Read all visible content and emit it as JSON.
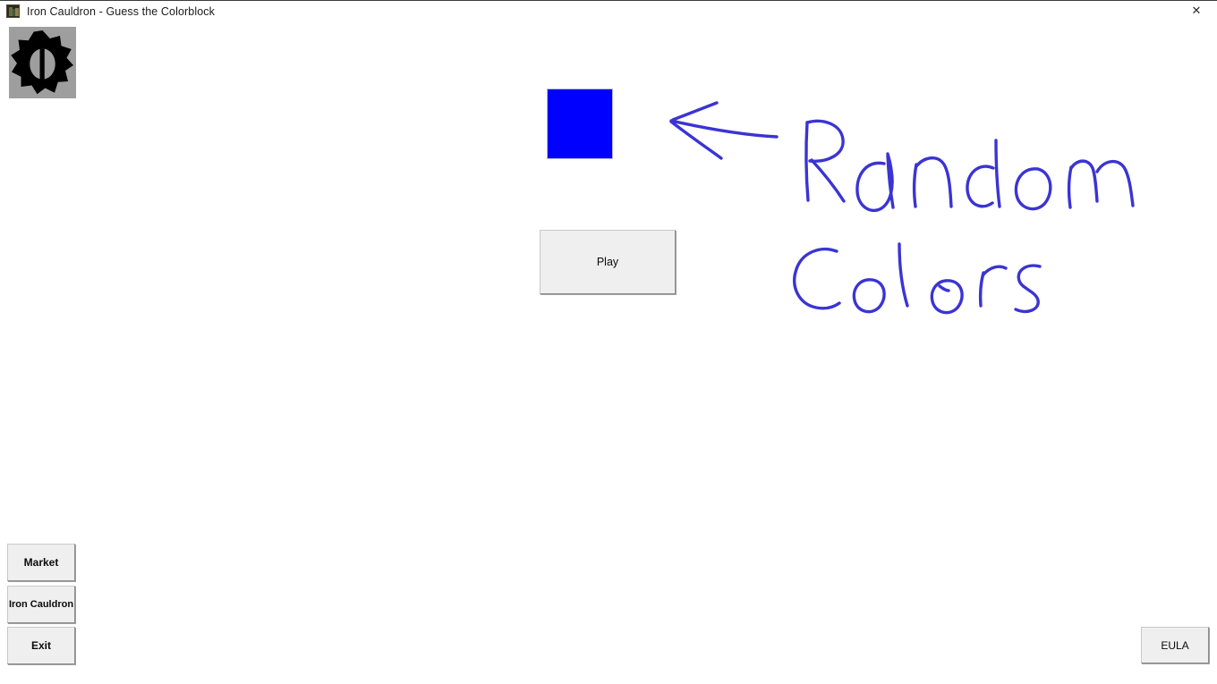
{
  "window": {
    "title": "Iron Cauldron - Guess the Colorblock",
    "app_icon_name": "iron-cauldron-app-icon",
    "close_label": "✕"
  },
  "logo": {
    "name": "gear-logo",
    "shape": "gear-cog",
    "fill_color": "#000000",
    "background_color": "#9e9e9e"
  },
  "game": {
    "colorblock": {
      "label": "color-swatch",
      "color": "#0000FF",
      "border_color": "#B9B9E8"
    },
    "play_label": "Play"
  },
  "menu": {
    "market_label": "Market",
    "cauldron_label": "Iron Cauldron",
    "exit_label": "Exit",
    "eula_label": "EULA"
  },
  "annotation": {
    "ink_color": "#3A34D4",
    "arrow": "left-pointing-arrow",
    "line_1": "Random",
    "line_2": "Colors",
    "full_text": "Random Colors"
  },
  "theme": {
    "background": "#FFFFFF",
    "button_face": "#EFEFEF",
    "button_shadow": "#A0A0A0",
    "text": "#0B0B0B"
  }
}
